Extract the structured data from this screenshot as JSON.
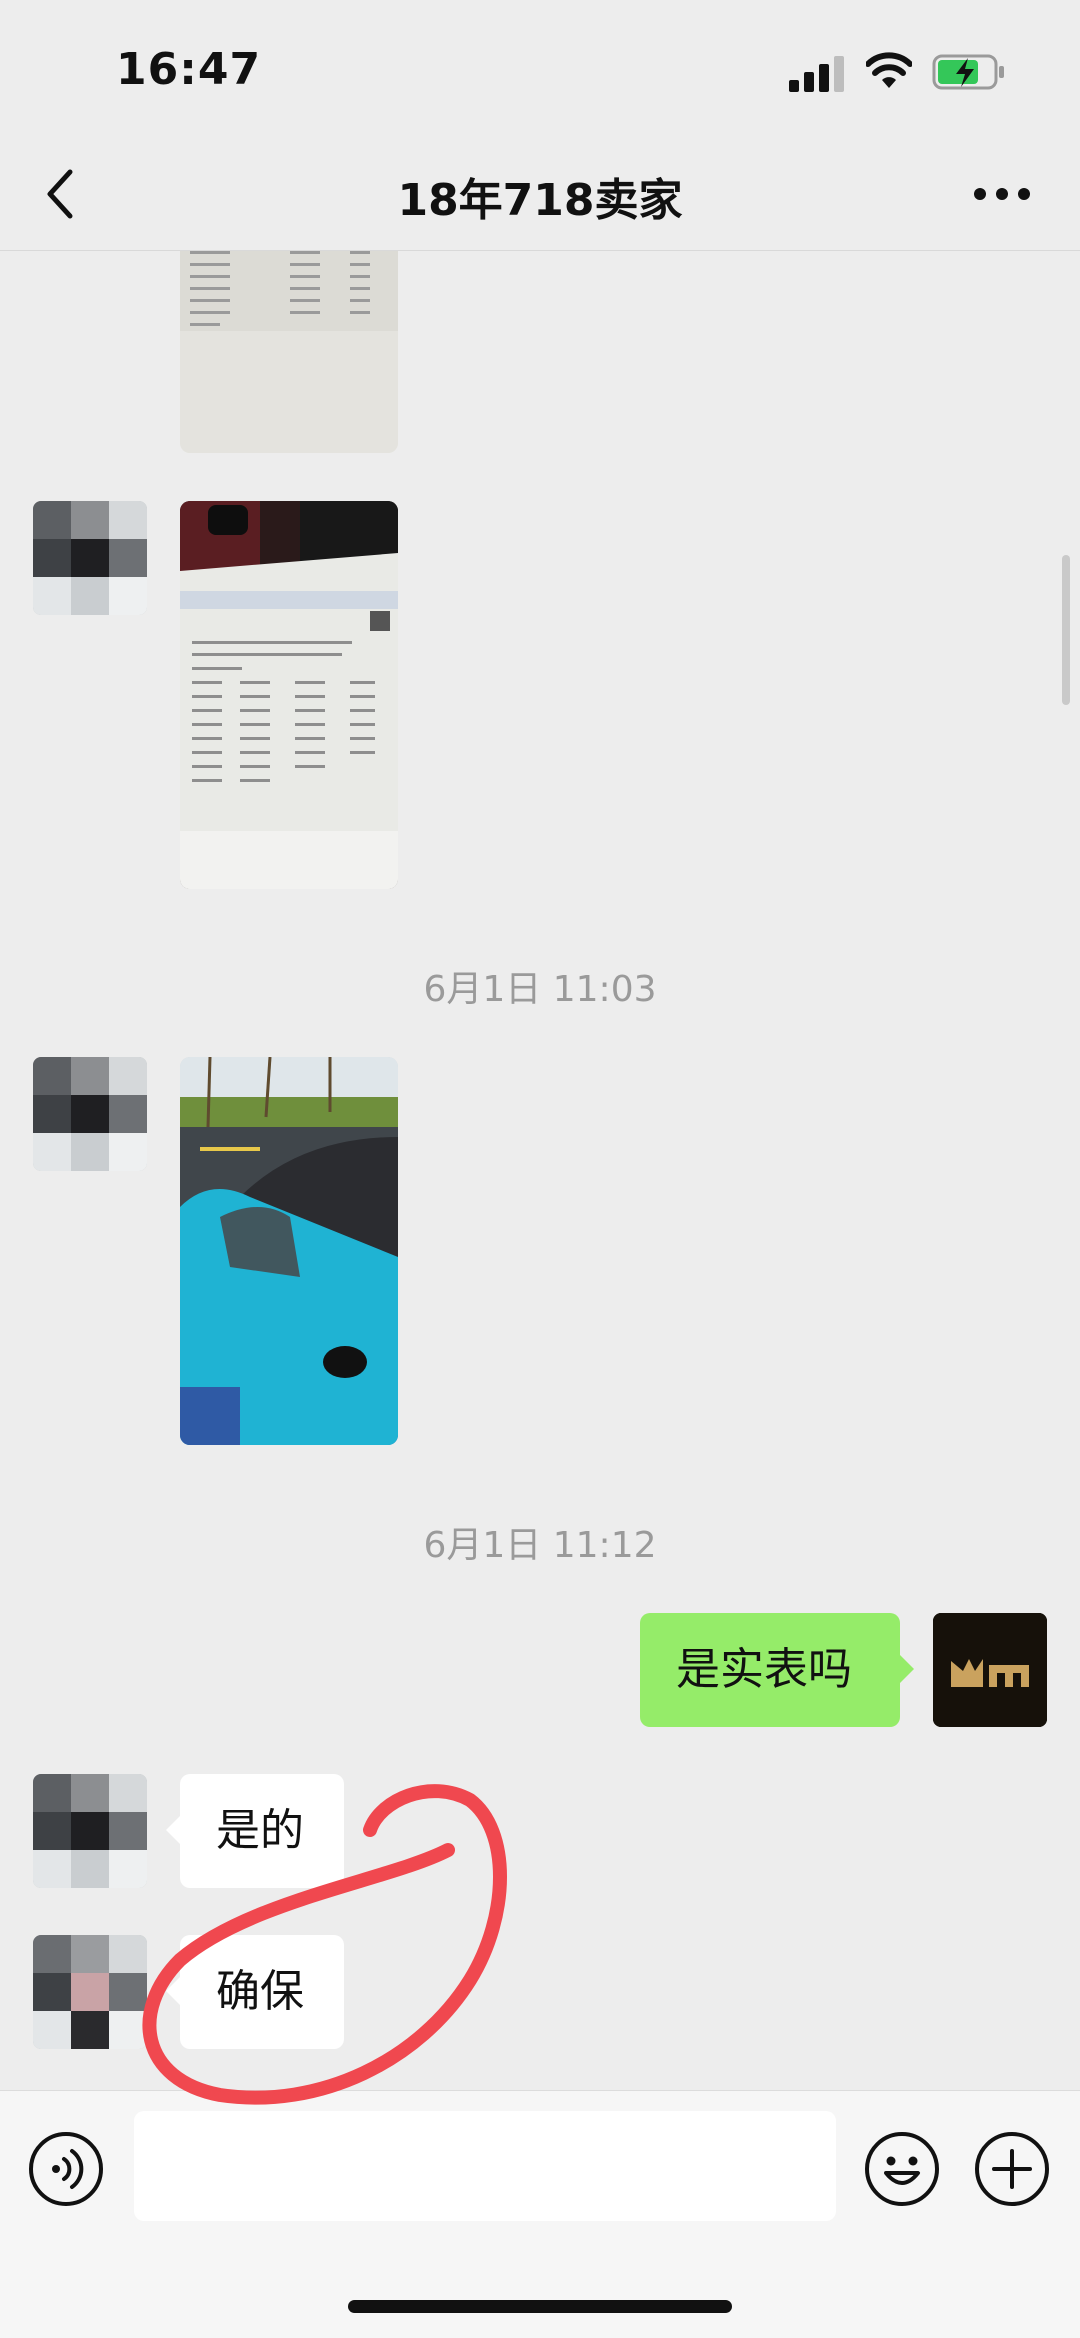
{
  "status_bar": {
    "time": "16:47",
    "icons": [
      "cellular-signal-icon",
      "wifi-icon",
      "battery-charging-icon"
    ]
  },
  "header": {
    "back_icon": "chevron-left-icon",
    "title": "18年718卖家",
    "more_icon": "ellipsis-icon"
  },
  "messages": [
    {
      "type": "image",
      "sender": "contact",
      "subject": "document photo"
    },
    {
      "type": "image",
      "sender": "contact",
      "subject": "document photo"
    },
    {
      "type": "timestamp",
      "text": "6月1日 11:03"
    },
    {
      "type": "image",
      "sender": "contact",
      "subject": "blue sports car photo"
    },
    {
      "type": "timestamp",
      "text": "6月1日 11:12"
    },
    {
      "type": "text",
      "sender": "me",
      "text": "是实表吗"
    },
    {
      "type": "text",
      "sender": "contact",
      "text": "是的"
    },
    {
      "type": "text",
      "sender": "contact",
      "text": "确保"
    }
  ],
  "input_bar": {
    "voice_icon": "voice-icon",
    "input_value": "",
    "emoji_icon": "emoji-icon",
    "plus_icon": "plus-icon"
  },
  "colors": {
    "background": "#ededed",
    "my_bubble": "#95ec69",
    "contact_bubble": "#ffffff",
    "annotation_circle": "#f0484f"
  }
}
